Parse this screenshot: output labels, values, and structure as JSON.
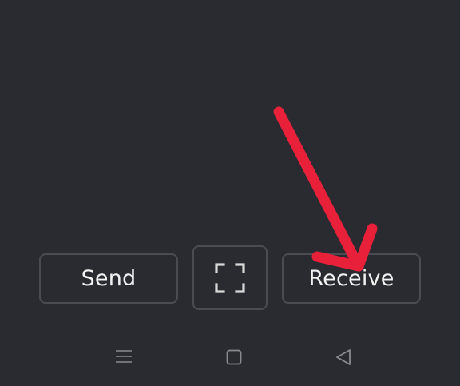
{
  "actions": {
    "send_label": "Send",
    "scan_icon": "scan-qr-icon",
    "receive_label": "Receive"
  },
  "navigation_bar": {
    "menu_icon": "menu-icon",
    "home_icon": "home-icon",
    "back_icon": "back-icon"
  },
  "annotation": {
    "type": "arrow",
    "color": "#e8203a",
    "target": "receive-button"
  },
  "colors": {
    "background": "#2a2b30",
    "button_border": "#4a4c52",
    "text": "#f2f2f2",
    "nav_icon": "#8a8b90"
  }
}
